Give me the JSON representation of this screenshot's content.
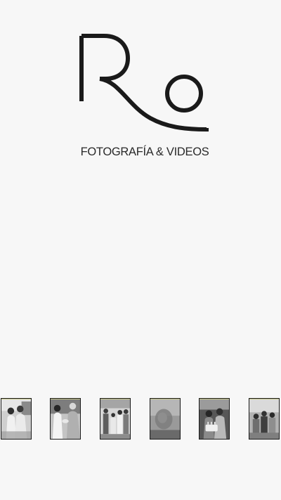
{
  "brand": {
    "logo_letters": "Ro",
    "subtitle": "FOTOGRAFÍA & VIDEOS"
  },
  "gallery": {
    "thumbnails": [
      {
        "alt": "couple-portrait"
      },
      {
        "alt": "couple-with-elder"
      },
      {
        "alt": "family-group"
      },
      {
        "alt": "blurred-portrait"
      },
      {
        "alt": "birthday-cake"
      },
      {
        "alt": "family-outdoor"
      }
    ]
  },
  "colors": {
    "background": "#f7f7f7",
    "ink": "#1a1a1a",
    "thumb_edge_accent": "#c9c98a"
  }
}
